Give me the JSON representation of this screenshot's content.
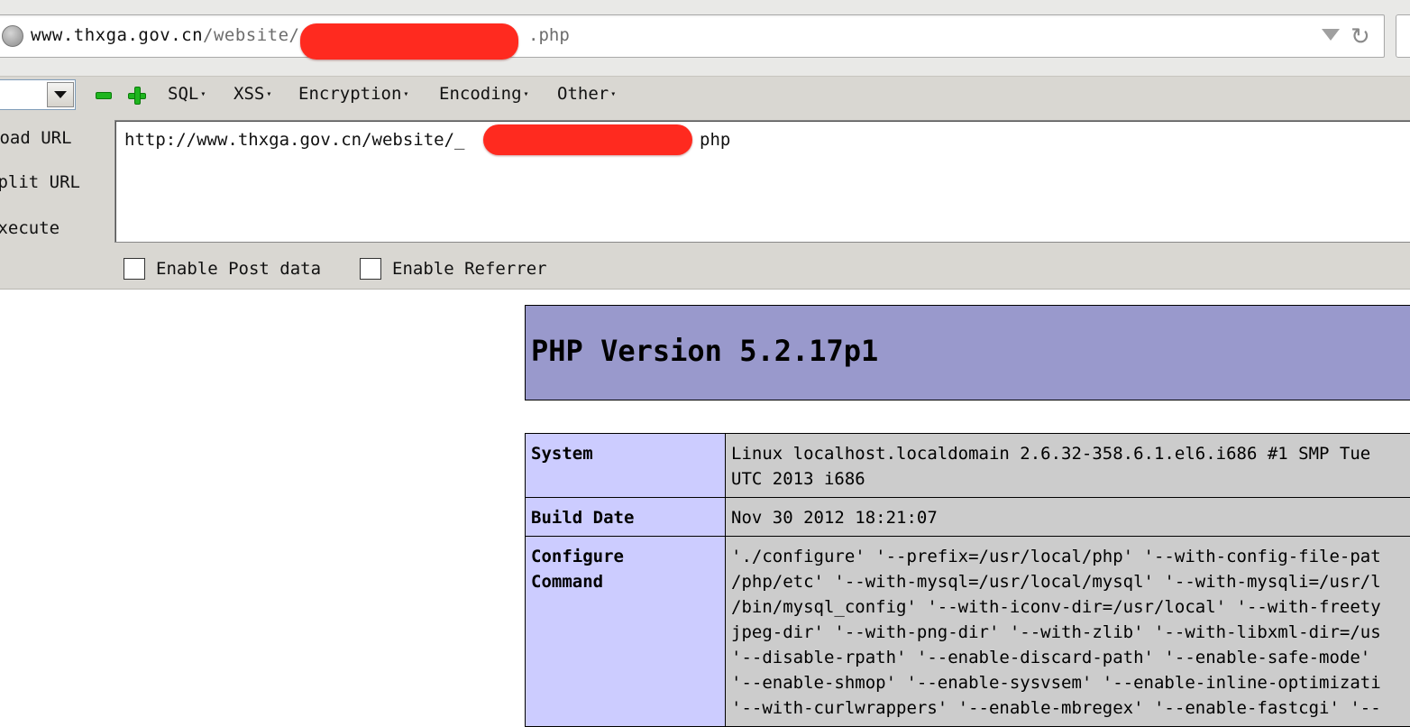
{
  "browser": {
    "url_host": "www.thxga.gov.cn",
    "url_path": "/website/",
    "url_suffix": ".php"
  },
  "hackbar": {
    "menus": [
      {
        "label": "SQL"
      },
      {
        "label": "XSS"
      },
      {
        "label": "Encryption"
      },
      {
        "label": "Encoding"
      },
      {
        "label": "Other"
      }
    ],
    "side_buttons": {
      "load": "Load URL",
      "split": "Split URL",
      "execute": "Execute"
    },
    "url_prefix": "http://www.thxga.gov.cn/website/_",
    "url_suffix": "php",
    "enable_post_label": "Enable Post data",
    "enable_referrer_label": "Enable Referrer"
  },
  "phpinfo": {
    "title": "PHP Version 5.2.17p1",
    "rows": [
      {
        "label": "System",
        "lines": [
          "Linux localhost.localdomain 2.6.32-358.6.1.el6.i686 #1 SMP Tue",
          "UTC 2013 i686"
        ]
      },
      {
        "label": "Build Date",
        "lines": [
          "Nov 30 2012 18:21:07"
        ]
      },
      {
        "label_lines": [
          "Configure",
          "Command"
        ],
        "lines": [
          "'./configure' '--prefix=/usr/local/php' '--with-config-file-pat",
          "/php/etc' '--with-mysql=/usr/local/mysql' '--with-mysqli=/usr/l",
          "/bin/mysql_config' '--with-iconv-dir=/usr/local' '--with-freety",
          "jpeg-dir' '--with-png-dir' '--with-zlib' '--with-libxml-dir=/us",
          "'--disable-rpath' '--enable-discard-path' '--enable-safe-mode'",
          "'--enable-shmop' '--enable-sysvsem' '--enable-inline-optimizati",
          "'--with-curlwrappers' '--enable-mbregex' '--enable-fastcgi' '--"
        ]
      }
    ]
  },
  "colors": {
    "header_bg": "#9999cc",
    "label_bg": "#ccccff",
    "value_bg": "#cccccc",
    "redaction": "#ff2a1f"
  }
}
